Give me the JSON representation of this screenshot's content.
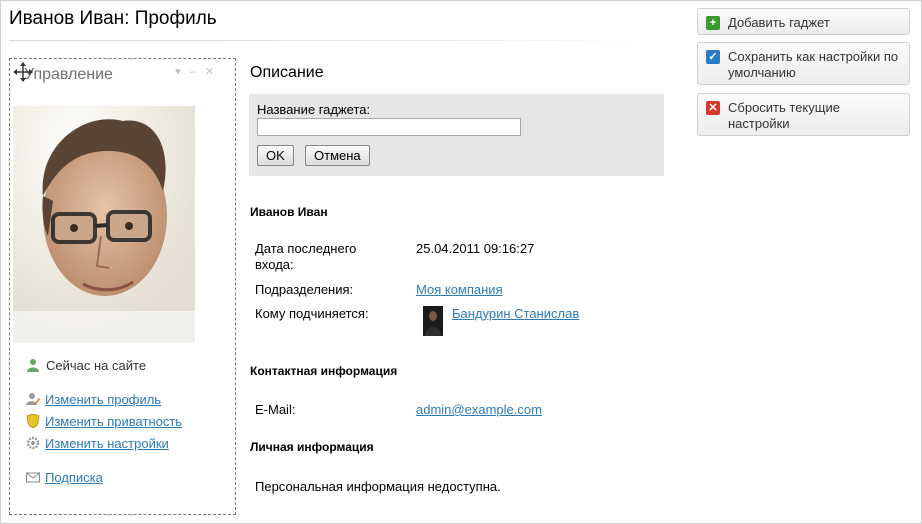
{
  "page": {
    "title": "Иванов Иван: Профиль"
  },
  "gadget": {
    "title": "Управление",
    "status": "Сейчас на сайте",
    "links": {
      "edit_profile": "Изменить профиль",
      "edit_privacy": "Изменить приватность",
      "edit_settings": "Изменить настройки",
      "subscription": "Подписка"
    }
  },
  "description": {
    "title": "Описание",
    "rename": {
      "label": "Название гаджета:",
      "value": "",
      "ok": "OK",
      "cancel": "Отмена"
    }
  },
  "profile": {
    "name": "Иванов Иван",
    "last_login_label": "Дата последнего входа:",
    "last_login_value": "25.04.2011 09:16:27",
    "departments_label": "Подразделения:",
    "departments_value": "Моя компания",
    "manager_label": "Кому подчиняется:",
    "manager_value": "Бандурин Станислав"
  },
  "contact": {
    "title": "Контактная информация",
    "email_label": "E-Mail:",
    "email_value": "admin@example.com"
  },
  "personal": {
    "title": "Личная информация",
    "text": "Персональная информация недоступна."
  },
  "actions": {
    "add_gadget": "Добавить гаджет",
    "save_default": "Сохранить как настройки по умолчанию",
    "reset": "Сбросить текущие настройки"
  },
  "colors": {
    "link": "#2b7bb9",
    "add": "#3a9a2e",
    "save": "#2a7bc6",
    "reset": "#d6382b"
  },
  "icons": [
    "move-icon",
    "online-user-icon",
    "edit-profile-icon",
    "privacy-shield-icon",
    "settings-gear-icon",
    "subscription-mail-icon",
    "plus-icon",
    "checkmark-icon",
    "cross-icon"
  ]
}
